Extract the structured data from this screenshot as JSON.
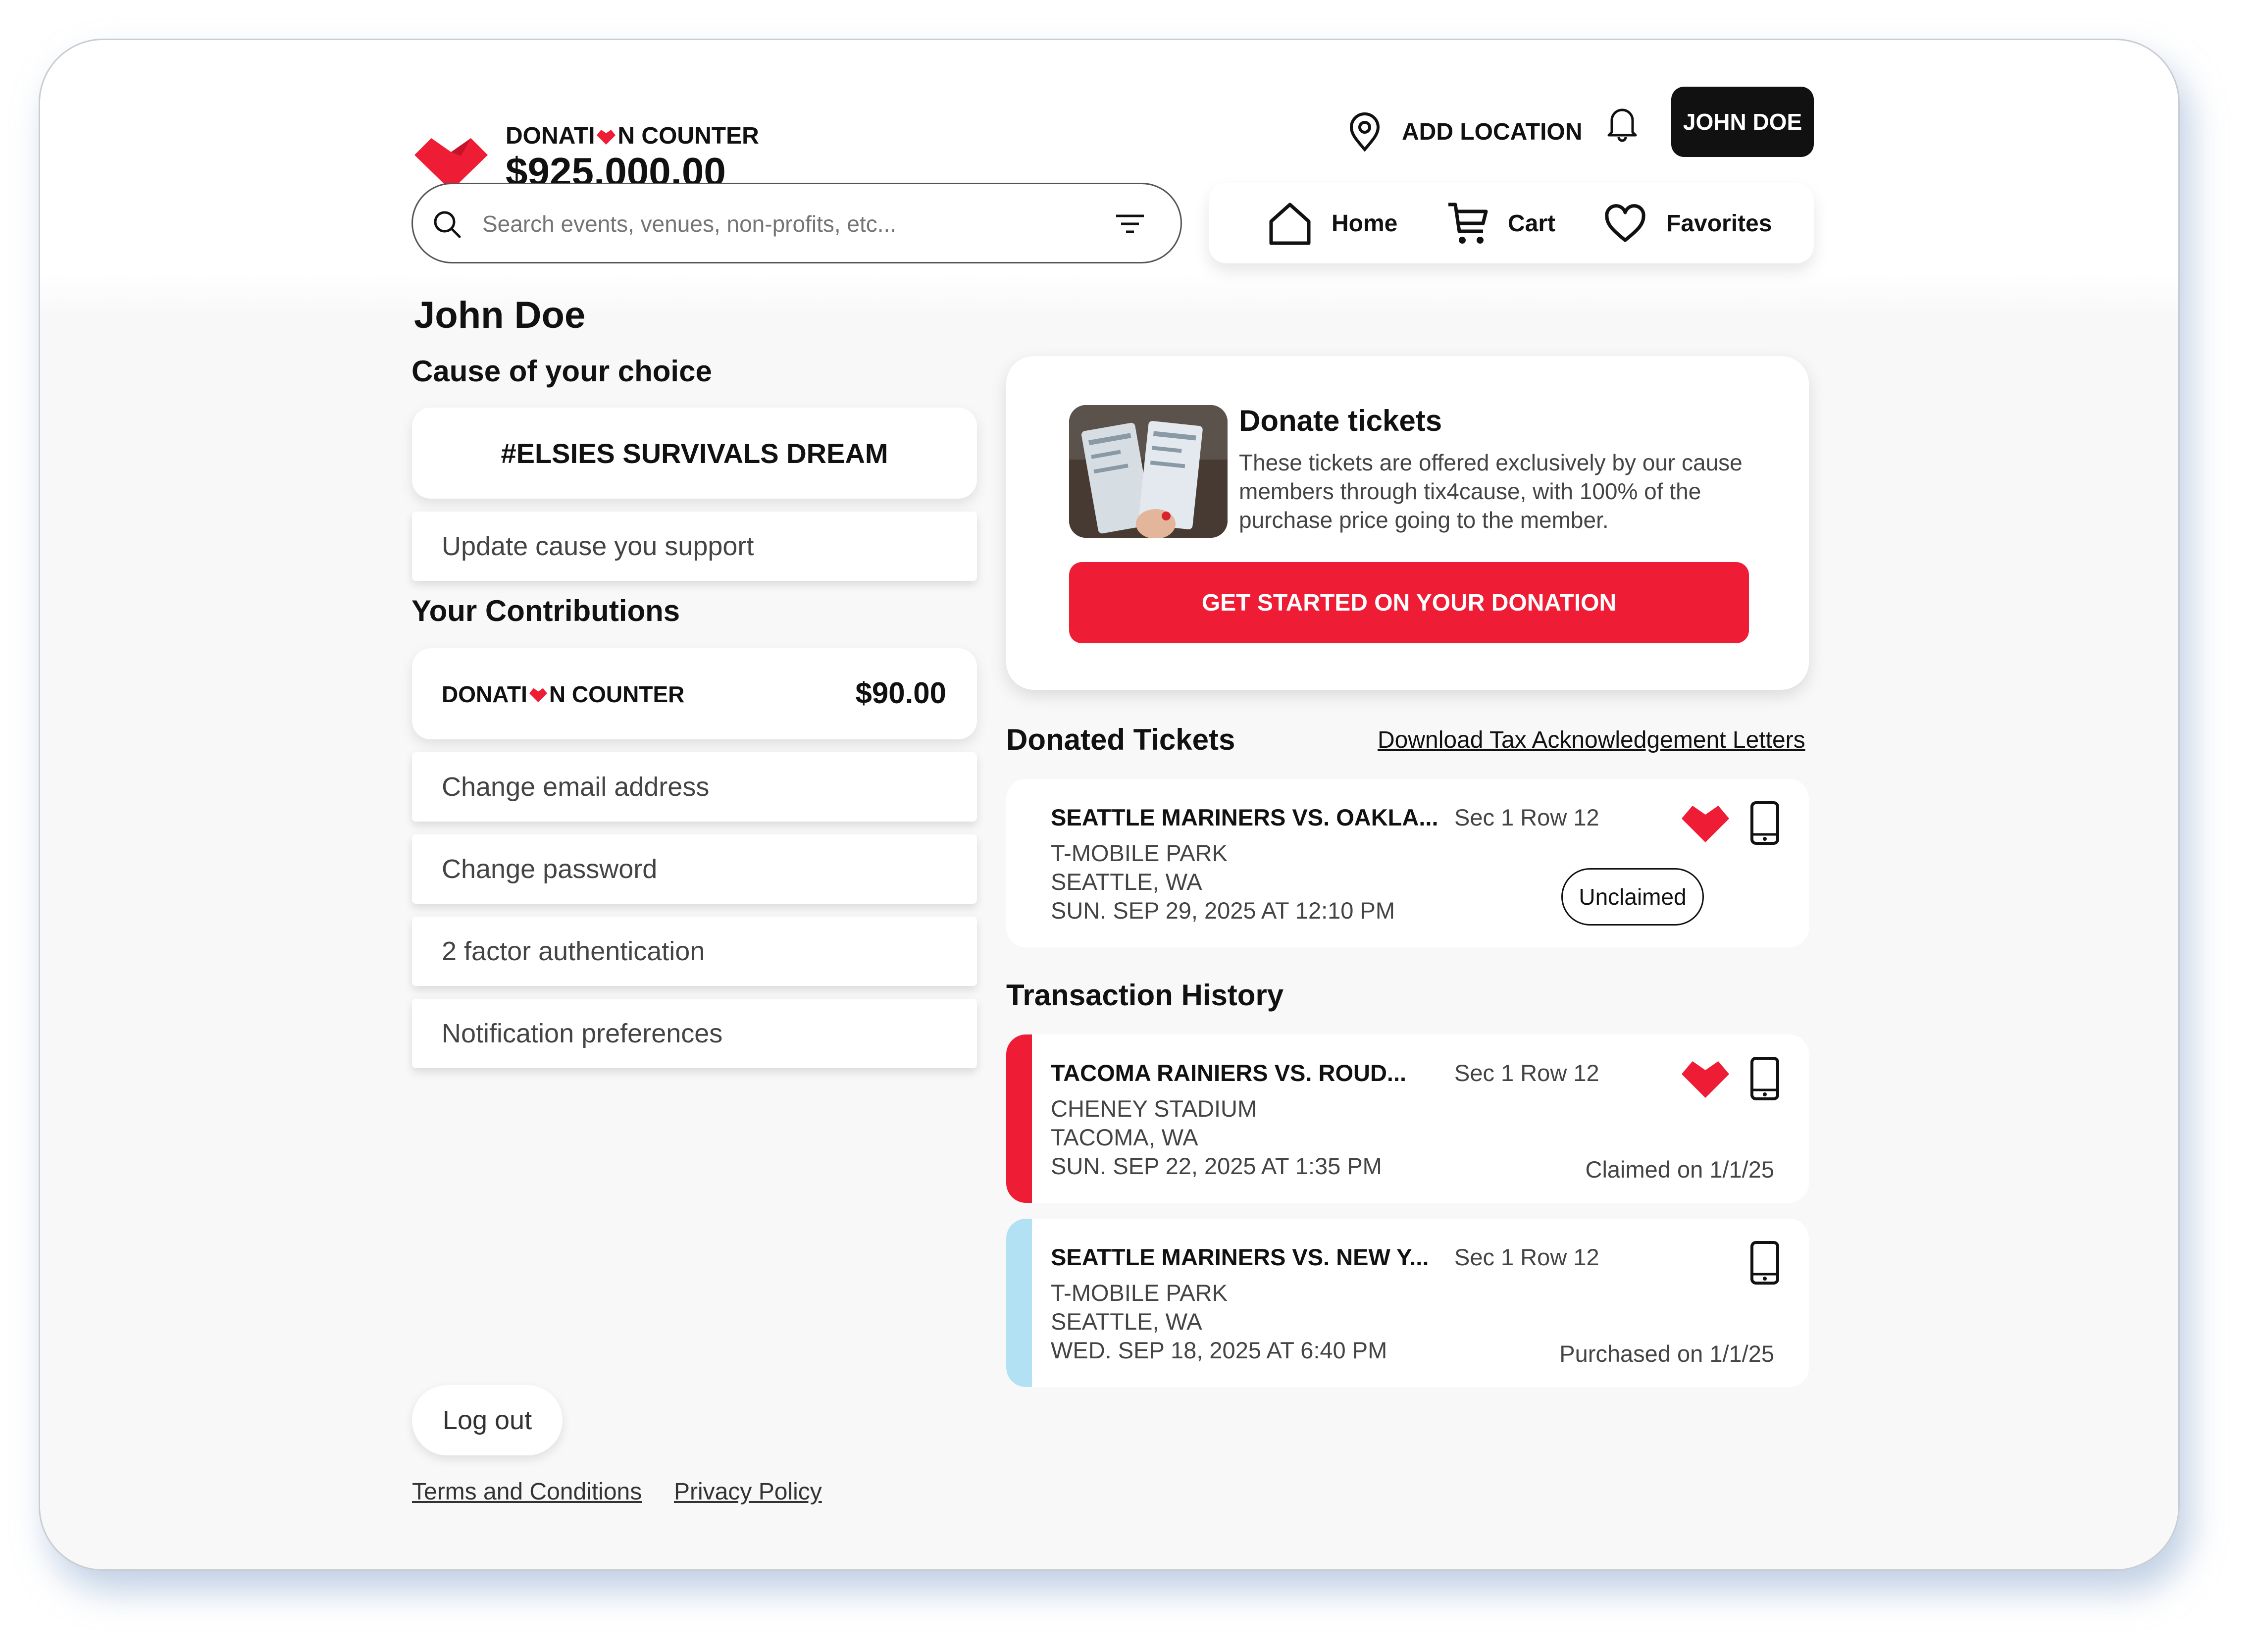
{
  "header": {
    "brand_prefix": "DONATI",
    "brand_suffix": "N COUNTER",
    "counter_amount": "$925,000.00",
    "add_location_label": "ADD LOCATION",
    "user_button_label": "JOHN DOE"
  },
  "search": {
    "placeholder": "Search events, venues, non-profits, etc..."
  },
  "nav": {
    "home_label": "Home",
    "cart_label": "Cart",
    "favorites_label": "Favorites"
  },
  "profile": {
    "name": "John Doe",
    "cause_heading": "Cause of your choice",
    "cause_name": "#ELSIES SURVIVALS DREAM",
    "update_cause_label": "Update cause you support",
    "contributions_heading": "Your Contributions",
    "contribution_brand_prefix": "DONATI",
    "contribution_brand_suffix": "N COUNTER",
    "contribution_amount": "$90.00",
    "change_email_label": "Change email address",
    "change_password_label": "Change password",
    "two_factor_label": "2 factor authentication",
    "notification_label": "Notification preferences",
    "logout_label": "Log out",
    "terms_label": "Terms and Conditions",
    "privacy_label": "Privacy Policy"
  },
  "donate_card": {
    "title": "Donate tickets",
    "description": "These tickets are offered exclusively by our cause members through tix4cause, with 100% of the purchase price going to the member.",
    "cta_label": "GET STARTED ON YOUR DONATION"
  },
  "donated_tickets": {
    "heading": "Donated Tickets",
    "download_label": "Download Tax Acknowledgement Letters",
    "items": [
      {
        "title": "SEATTLE MARINERS VS. OAKLA...",
        "seat": "Sec 1 Row 12",
        "venue": "T-MOBILE PARK",
        "city": "SEATTLE, WA",
        "date": "SUN. SEP 29, 2025 AT 12:10 PM",
        "status": "Unclaimed"
      }
    ]
  },
  "transactions": {
    "heading": "Transaction History",
    "items": [
      {
        "title": "TACOMA RAINIERS VS. ROUD...",
        "seat": "Sec 1 Row 12",
        "venue": "CHENEY STADIUM",
        "city": "TACOMA, WA",
        "date": "SUN. SEP 22, 2025 AT 1:35 PM",
        "status": "Claimed on 1/1/25",
        "stripe_color": "#ee1c35"
      },
      {
        "title": "SEATTLE MARINERS VS. NEW Y...",
        "seat": "Sec 1 Row 12",
        "venue": "T-MOBILE PARK",
        "city": "SEATTLE, WA",
        "date": "WED. SEP 18, 2025 AT 6:40 PM",
        "status": "Purchased on 1/1/25",
        "stripe_color": "#b3e1f4"
      }
    ]
  },
  "colors": {
    "brand_red": "#ee1c35",
    "dark": "#111111",
    "light_blue": "#b3e1f4"
  }
}
